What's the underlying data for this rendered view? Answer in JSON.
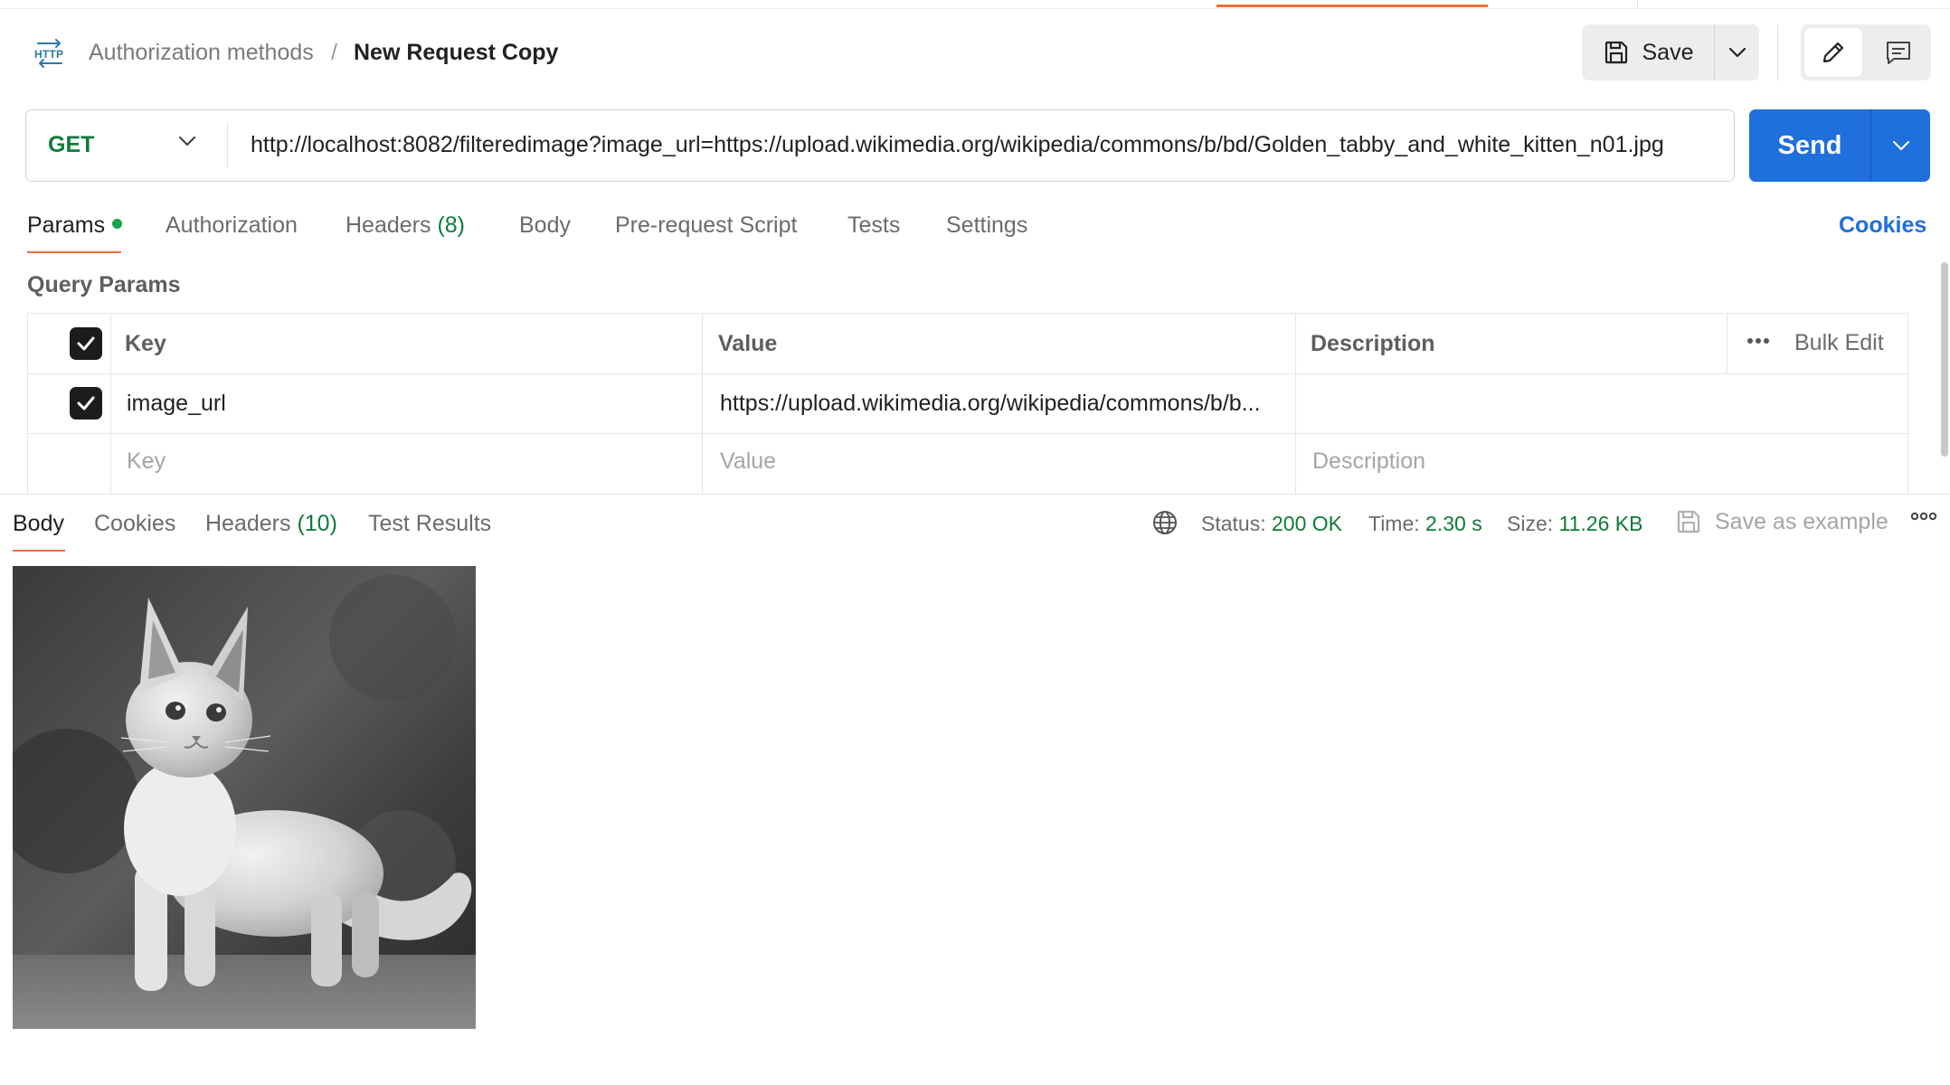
{
  "header": {
    "breadcrumb_parent": "Authorization methods",
    "breadcrumb_sep": "/",
    "breadcrumb_current": "New Request Copy",
    "save_label": "Save"
  },
  "request": {
    "method": "GET",
    "url": "http://localhost:8082/filteredimage?image_url=https://upload.wikimedia.org/wikipedia/commons/b/bd/Golden_tabby_and_white_kitten_n01.jpg",
    "send_label": "Send"
  },
  "tabs": [
    {
      "label": "Params"
    },
    {
      "label": "Authorization"
    },
    {
      "label": "Headers",
      "count": "(8)"
    },
    {
      "label": "Body"
    },
    {
      "label": "Pre-request Script"
    },
    {
      "label": "Tests"
    },
    {
      "label": "Settings"
    }
  ],
  "cookies_link": "Cookies",
  "query_params": {
    "title": "Query Params",
    "columns": [
      "Key",
      "Value",
      "Description"
    ],
    "bulk_edit": "Bulk Edit",
    "rows": [
      {
        "key": "image_url",
        "value": "https://upload.wikimedia.org/wikipedia/commons/b/b...",
        "description": ""
      }
    ],
    "placeholders": {
      "key": "Key",
      "value": "Value",
      "description": "Description"
    }
  },
  "response": {
    "tabs": [
      {
        "label": "Body"
      },
      {
        "label": "Cookies"
      },
      {
        "label": "Headers",
        "count": "(10)"
      },
      {
        "label": "Test Results"
      }
    ],
    "status_label": "Status:",
    "status_value": "200 OK",
    "time_label": "Time:",
    "time_value": "2.30 s",
    "size_label": "Size:",
    "size_value": "11.26 KB",
    "save_example": "Save as example"
  },
  "colors": {
    "accent_orange": "#f26b3a",
    "send_blue": "#1f6fdc",
    "success_green": "#0f7b3a"
  }
}
